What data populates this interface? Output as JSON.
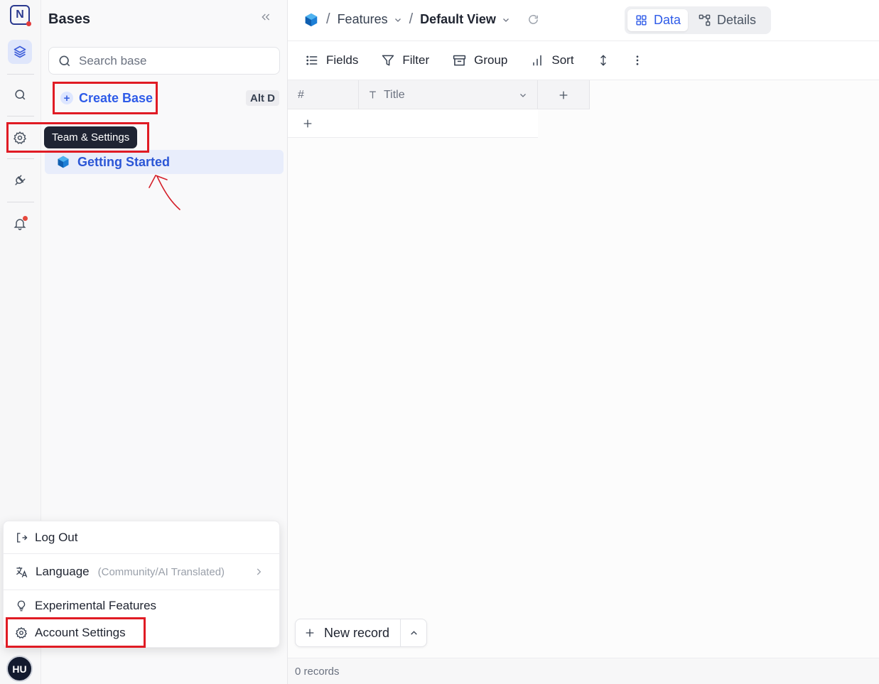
{
  "rail": {
    "logo_letter": "N",
    "items": [
      {
        "name": "bases",
        "icon": "layers-icon"
      },
      {
        "name": "search",
        "icon": "search-icon"
      },
      {
        "name": "team-settings",
        "icon": "gear-icon"
      },
      {
        "name": "integrations",
        "icon": "plug-icon"
      },
      {
        "name": "notifications",
        "icon": "bell-icon"
      }
    ],
    "avatar_initials": "HU"
  },
  "sidebar": {
    "title": "Bases",
    "search_placeholder": "Search base",
    "create_base_label": "Create Base",
    "create_base_shortcut": "Alt D",
    "tooltip": "Team & Settings",
    "bases": [
      {
        "label": "Getting Started"
      }
    ]
  },
  "account_menu": {
    "items": [
      {
        "label": "Log Out",
        "icon": "logout-icon"
      },
      {
        "label": "Language",
        "note": "(Community/AI Translated)",
        "icon": "translate-icon"
      },
      {
        "label": "Experimental Features",
        "icon": "lightbulb-icon"
      },
      {
        "label": "Account Settings",
        "icon": "gear-icon"
      }
    ]
  },
  "topbar": {
    "table": "Features",
    "view": "Default View",
    "toggle": [
      {
        "label": "Data",
        "active": true
      },
      {
        "label": "Details",
        "active": false
      }
    ]
  },
  "toolbar": {
    "fields": "Fields",
    "filter": "Filter",
    "group": "Group",
    "sort": "Sort"
  },
  "grid": {
    "columns": [
      {
        "label": "#"
      },
      {
        "label": "Title"
      }
    ],
    "new_record": "New record",
    "records_count": "0 records"
  },
  "colors": {
    "accent": "#2e5be8",
    "highlight": "#e01b24"
  }
}
